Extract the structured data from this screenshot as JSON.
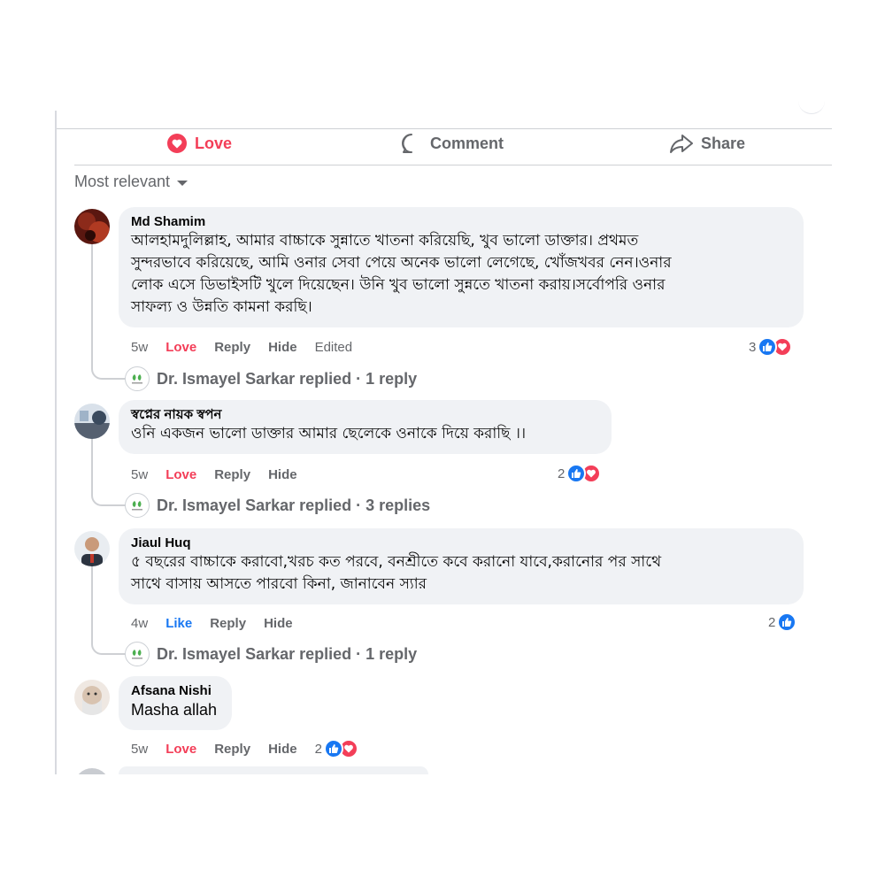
{
  "actions": {
    "love": "Love",
    "comment": "Comment",
    "share": "Share"
  },
  "sort": {
    "label": "Most relevant"
  },
  "reply_actions": {
    "love": "Love",
    "like": "Like",
    "reply": "Reply",
    "hide": "Hide",
    "edited": "Edited"
  },
  "colors": {
    "love": "#f33e58",
    "like": "#1877f2",
    "muted": "#65676b",
    "bubble": "#f0f2f5"
  },
  "comments": [
    {
      "author": "Md Shamim",
      "lines": [
        "আলহামদুলিল্লাহ, আমার বাচ্চাকে সুন্নাতে খাতনা করিয়েছি, খুব ভালো ডাক্তার। প্রথমত",
        "সুন্দরভাবে করিয়েছে, আমি ওনার সেবা পেয়ে অনেক ভালো লেগেছে, খোঁজখবর নেন।ওনার",
        "লোক এসে ডিভাইসটি খুলে দিয়েছেন। উনি খুব ভালো সুন্নতে খাতনা করায়।সর্বোপরি ওনার",
        "সাফল্য ও উন্নতি কামনা করছি।"
      ],
      "time": "5w",
      "reaction_count": "3",
      "reply_summary": "Dr. Ismayel Sarkar replied · 1 reply"
    },
    {
      "author": "স্বপ্নের নায়ক স্বপন",
      "lines": [
        "ওনি একজন ভালো ডাক্তার আমার ছেলেকে ওনাকে দিয়ে করাছি ।।"
      ],
      "time": "5w",
      "reaction_count": "2",
      "reply_summary": "Dr. Ismayel Sarkar replied · 3 replies"
    },
    {
      "author": "Jiaul Huq",
      "lines": [
        "৫ বছরের বাচ্চাকে করাবো,খরচ কত পরবে, বনশ্রীতে কবে করানো যাবে,করানোর পর সাথে",
        "সাথে বাসায় আসতে পারবো কিনা, জানাবেন স্যার"
      ],
      "time": "4w",
      "reaction_count": "2",
      "reply_summary": "Dr. Ismayel Sarkar replied · 1 reply"
    },
    {
      "author": "Afsana Nishi",
      "lines": [
        "Masha allah"
      ],
      "time": "5w",
      "reaction_count": "2"
    }
  ]
}
